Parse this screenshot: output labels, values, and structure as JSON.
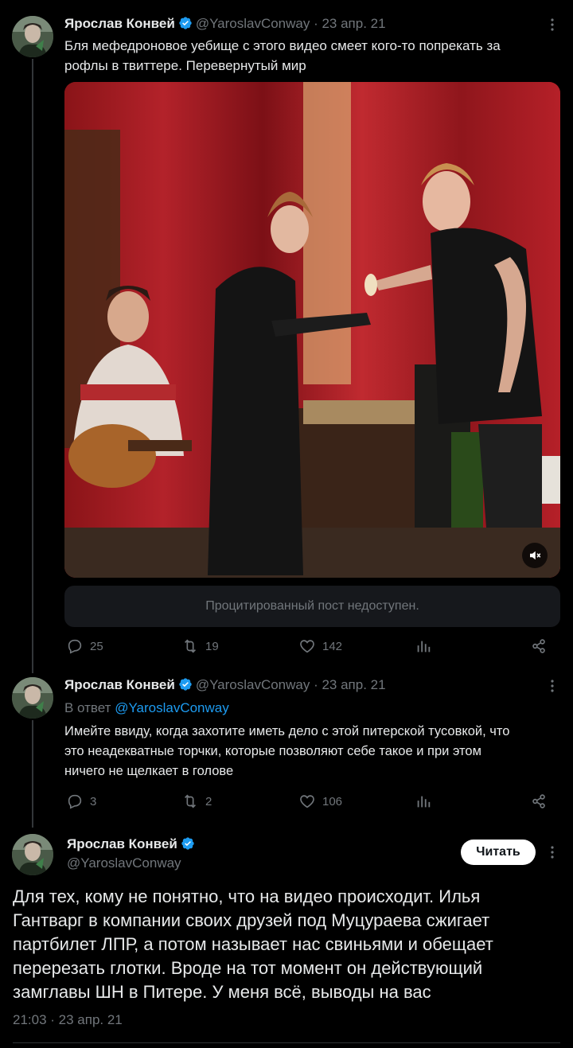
{
  "colors": {
    "accent": "#1d9bf0",
    "text": "#e7e9ea",
    "muted": "#71767b",
    "background": "#000000"
  },
  "tweet1": {
    "author_name": "Ярослав Конвей",
    "handle_date": "@YaroslavConway · 23 апр. 21",
    "text_line1": "Бля мефедроновое уебище с этого видео смеет кого-то попрекать за",
    "text_line2": "рофлы в твиттере. Перевернутый мир",
    "quoted_unavailable": "Процитированный пост недоступен.",
    "replies": "25",
    "retweets": "19",
    "likes": "142"
  },
  "tweet2": {
    "author_name": "Ярослав Конвей",
    "handle_date": "@YaroslavConway · 23 апр. 21",
    "reply_prefix": "В ответ",
    "reply_handle": "@YaroslavConway",
    "text_line1": "Имейте ввиду, когда захотите иметь дело с этой питерской тусовкой, что",
    "text_line2": "это неадекватные торчки, которые позволяют себе такое и при этом",
    "text_line3": "ничего не щелкает в голове",
    "replies": "3",
    "retweets": "2",
    "likes": "106"
  },
  "main_tweet": {
    "author_name": "Ярослав Конвей",
    "handle": "@YaroslavConway",
    "follow_label": "Читать",
    "text_line1": "Для тех, кому не понятно, что на видео происходит. Илья",
    "text_line2": "Гантварг в компании своих друзей под Муцураева сжигает",
    "text_line3": "партбилет ЛПР, а потом называет нас свиньями и обещает",
    "text_line4": "перерезать глотки. Вроде на тот момент он действующий",
    "text_line5": "замглавы ШН в Питере. У меня всё, выводы на вас",
    "timestamp": "21:03 · 23 апр. 21"
  },
  "icons": [
    "verified-badge-icon",
    "more-icon",
    "reply-icon",
    "retweet-icon",
    "like-icon",
    "views-icon",
    "share-icon",
    "mute-icon"
  ]
}
